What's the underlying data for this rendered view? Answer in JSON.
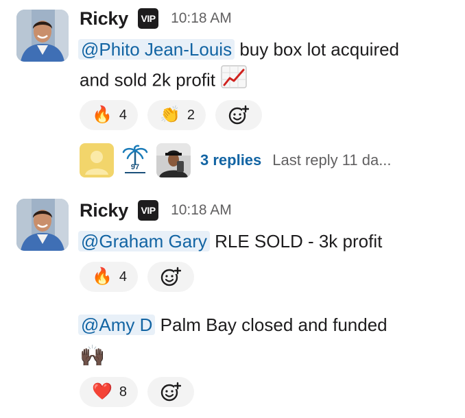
{
  "messages": [
    {
      "author": "Ricky",
      "badge": "VIP",
      "time": "10:18 AM",
      "mention": "@Phito Jean-Louis",
      "text_line1": "buy box lot acquired",
      "text_line2": "and sold 2k profit",
      "inline_emoji": "chart-increasing-icon",
      "reactions": [
        {
          "emoji": "🔥",
          "count": "4"
        },
        {
          "emoji": "👏",
          "count": "2"
        }
      ],
      "thread": {
        "replies": "3 replies",
        "last_reply": "Last reply 11 da..."
      }
    },
    {
      "author": "Ricky",
      "badge": "VIP",
      "time": "10:18 AM",
      "mention": "@Graham Gary",
      "text": "RLE SOLD - 3k profit",
      "reactions": [
        {
          "emoji": "🔥",
          "count": "4"
        }
      ]
    },
    {
      "mention": "@Amy D",
      "text": "Palm Bay closed and funded",
      "emoji_line": "🙌🏿",
      "reactions": [
        {
          "emoji": "❤️",
          "count": "8"
        }
      ]
    }
  ],
  "colors": {
    "mention_bg": "#e8f0f8",
    "mention_text": "#1264a3",
    "reaction_bg": "#f3f3f3",
    "meta_text": "#616061",
    "link": "#1264a3"
  }
}
